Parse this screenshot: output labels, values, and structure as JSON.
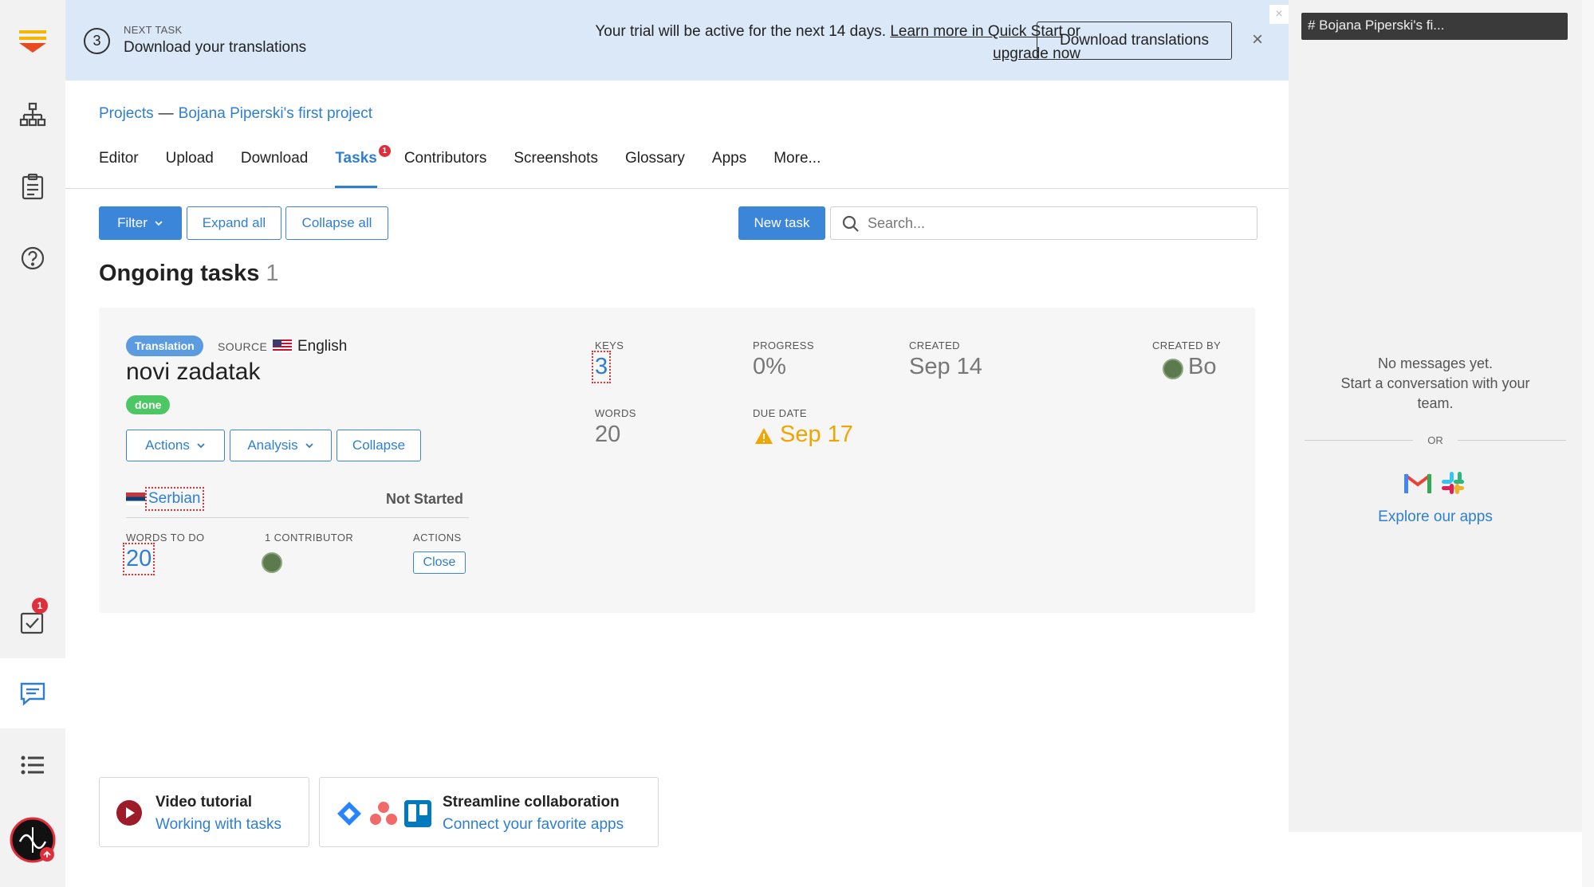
{
  "app": {
    "name": "Lokalise"
  },
  "rail": {
    "tasks_badge": "1"
  },
  "banner": {
    "step_number": "3",
    "next_label": "NEXT TASK",
    "next_title": "Download your translations",
    "trial_text": "Your trial will be active for the next 14 days.",
    "quick_start_link": "Learn more in Quick Start",
    "or_text": "or",
    "upgrade_link": "upgrade now",
    "download_button": "Download translations",
    "close_glyph": "×"
  },
  "breadcrumb": {
    "root": "Projects",
    "separator": "—",
    "project": "Bojana Piperski's first project"
  },
  "tabs": [
    {
      "label": "Editor"
    },
    {
      "label": "Upload"
    },
    {
      "label": "Download"
    },
    {
      "label": "Tasks",
      "badge": "1"
    },
    {
      "label": "Contributors"
    },
    {
      "label": "Screenshots"
    },
    {
      "label": "Glossary"
    },
    {
      "label": "Apps"
    },
    {
      "label": "More..."
    }
  ],
  "toolbar": {
    "filter_label": "Filter",
    "expand_label": "Expand all",
    "collapse_label": "Collapse all",
    "new_task_label": "New task",
    "search_placeholder": "Search..."
  },
  "section": {
    "title": "Ongoing tasks",
    "count": "1"
  },
  "task": {
    "type": "Translation",
    "source_label": "SOURCE",
    "source_language": "English",
    "name": "novi zadatak",
    "status_pill": "done",
    "actions_label": "Actions",
    "analysis_label": "Analysis",
    "collapse_label": "Collapse",
    "keys_label": "KEYS",
    "keys_value": "3",
    "words_label": "WORDS",
    "words_value": "20",
    "progress_label": "PROGRESS",
    "progress_value": "0%",
    "due_label": "DUE DATE",
    "due_value": "Sep 17",
    "created_label": "CREATED",
    "created_value": "Sep 14",
    "created_by_label": "CREATED BY",
    "created_by_value": "Bo",
    "target": {
      "language": "Serbian",
      "status": "Not Started",
      "words_todo_label": "WORDS TO DO",
      "words_todo_value": "20",
      "contributors_label": "1 CONTRIBUTOR",
      "actions_label": "ACTIONS",
      "close_label": "Close"
    }
  },
  "promos": [
    {
      "title": "Video tutorial",
      "subtitle": "Working with tasks"
    },
    {
      "title": "Streamline collaboration",
      "subtitle": "Connect your favorite apps"
    }
  ],
  "chat": {
    "channel": "# Bojana Piperski's fi...",
    "empty_line1": "No messages yet.",
    "empty_line2": "Start a conversation with your",
    "empty_line3": "team.",
    "or_label": "OR",
    "explore_link": "Explore our apps",
    "close_glyph": "×"
  },
  "colors": {
    "accent": "#3b86d8",
    "banner_bg": "#dbe8f7",
    "pill_translation": "#5b9be0",
    "pill_done": "#4cc764",
    "warning": "#f0a500",
    "badge": "#e02f3a"
  }
}
